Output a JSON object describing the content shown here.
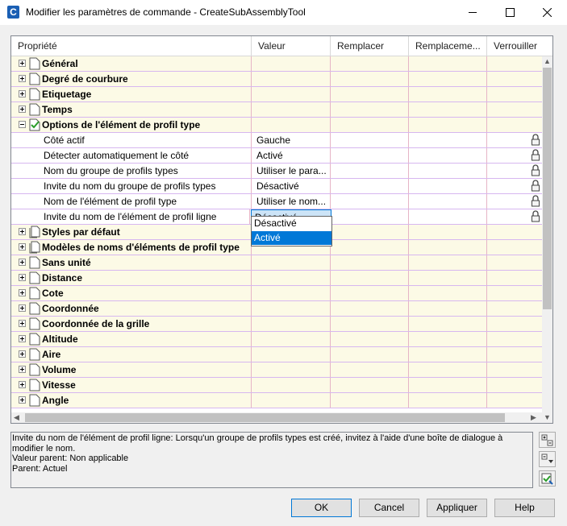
{
  "window": {
    "title": "Modifier les paramètres de commande - CreateSubAssemblyTool"
  },
  "grid": {
    "columns": [
      "Propriété",
      "Valeur",
      "Remplacer",
      "Remplaceme...",
      "Verrouiller"
    ],
    "groups_top": [
      {
        "label": "Général",
        "expanded": false
      },
      {
        "label": "Degré de courbure",
        "expanded": false
      },
      {
        "label": "Etiquetage",
        "expanded": false
      },
      {
        "label": "Temps",
        "expanded": false
      },
      {
        "label": "Options de l'élément de profil type",
        "expanded": true
      }
    ],
    "children": [
      {
        "label": "Côté actif",
        "value": "Gauche",
        "locked": true
      },
      {
        "label": "Détecter automatiquement le côté",
        "value": "Activé",
        "locked": true
      },
      {
        "label": "Nom du groupe de profils types",
        "value": "Utiliser le para...",
        "locked": true
      },
      {
        "label": "Invite du nom du groupe de profils types",
        "value": "Désactivé",
        "locked": true
      },
      {
        "label": "Nom de l'élément de profil type",
        "value": "Utiliser le nom...",
        "locked": true
      },
      {
        "label": "Invite du nom de l'élément de profil ligne",
        "value": "Désactivé",
        "locked": true
      }
    ],
    "groups_bottom": [
      {
        "label": "Styles par défaut",
        "expanded": false
      },
      {
        "label": "Modèles de noms d'éléments de profil type",
        "expanded": false
      },
      {
        "label": "Sans unité",
        "expanded": false
      },
      {
        "label": "Distance",
        "expanded": false
      },
      {
        "label": "Cote",
        "expanded": false
      },
      {
        "label": "Coordonnée",
        "expanded": false
      },
      {
        "label": "Coordonnée de la grille",
        "expanded": false
      },
      {
        "label": "Altitude",
        "expanded": false
      },
      {
        "label": "Aire",
        "expanded": false
      },
      {
        "label": "Volume",
        "expanded": false
      },
      {
        "label": "Vitesse",
        "expanded": false
      },
      {
        "label": "Angle",
        "expanded": false
      }
    ],
    "dropdown": {
      "options": [
        "Désactivé",
        "Activé"
      ],
      "highlighted": "Activé"
    }
  },
  "description": {
    "line1": "Invite du nom de l'élément de profil ligne: Lorsqu'un groupe de profils types est créé, invitez à l'aide d'une boîte de dialogue à modifier le nom.",
    "line2": "Valeur parent: Non applicable",
    "line3": "Parent: Actuel"
  },
  "buttons": {
    "ok": "OK",
    "cancel": "Cancel",
    "apply": "Appliquer",
    "help": "Help"
  },
  "colors": {
    "group_row_bg": "#fcfae6",
    "selection": "#0078d7",
    "accent_icon": "#1a5fb4"
  }
}
